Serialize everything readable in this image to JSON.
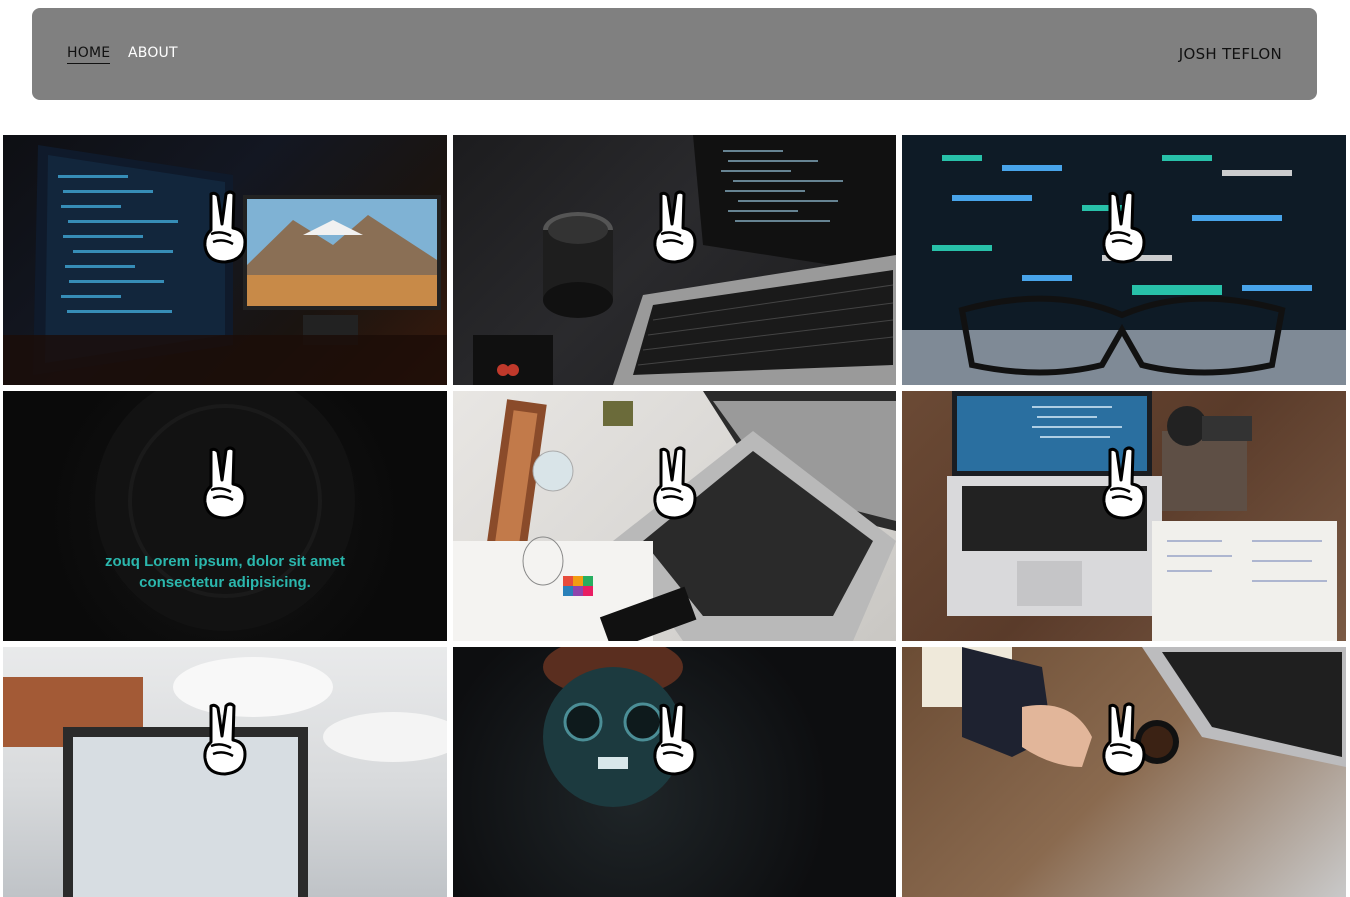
{
  "nav": {
    "home": "HOME",
    "about": "ABOUT",
    "brand": "JOSH TEFLON"
  },
  "tiles": [
    {
      "scene": "dual-monitor-desk-icon"
    },
    {
      "scene": "laptop-camera-lens-icon"
    },
    {
      "scene": "code-screen-glasses-icon"
    },
    {
      "scene": "dark-clock-icon",
      "caption": "zouq Lorem ipsum, dolor sit amet consectetur adipisicing."
    },
    {
      "scene": "laptop-drawing-desk-icon"
    },
    {
      "scene": "laptop-notebook-desk-icon"
    },
    {
      "scene": "laptop-white-sofa-icon"
    },
    {
      "scene": "hacker-skull-icon"
    },
    {
      "scene": "hands-laptop-coffee-icon"
    }
  ],
  "colors": {
    "navbar_bg": "#808080",
    "caption_color": "#2bb7ad",
    "nav_active": "#111111",
    "nav_link": "#ffffff"
  }
}
